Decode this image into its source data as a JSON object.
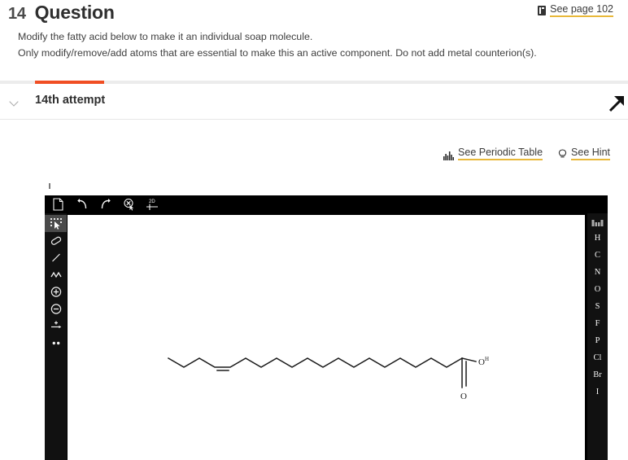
{
  "header": {
    "question_number": "14",
    "question_label": "Question",
    "instruction_1": "Modify the fatty acid below to make it an individual soap molecule.",
    "instruction_2": "Only modify/remove/add atoms that are essential to make this an active component. Do not add metal counterion(s).",
    "see_page_label": "See page 102",
    "see_page_icon": "book-icon"
  },
  "progress": {
    "fill_color": "#f04e23",
    "track_color": "#ececec"
  },
  "attempt": {
    "label": "14th attempt",
    "chevron_icon": "chevron-down-icon",
    "expand_icon": "arrow-up-right-icon"
  },
  "links": [
    {
      "label": "See Periodic Table",
      "icon": "periodic-table-icon",
      "underline_color": "#e8b83a"
    },
    {
      "label": "See Hint",
      "icon": "lightbulb-icon",
      "underline_color": "#e8b83a"
    }
  ],
  "editor": {
    "top_tools": [
      {
        "name": "new-document-icon",
        "label": "New"
      },
      {
        "name": "undo-icon",
        "label": "Undo"
      },
      {
        "name": "redo-icon",
        "label": "Redo"
      },
      {
        "name": "erase-cursor-icon",
        "label": "Erase"
      },
      {
        "name": "clean-up-2d-icon",
        "label": "2D"
      }
    ],
    "left_tools": [
      {
        "name": "select-tool-icon",
        "label": "Select",
        "active": true
      },
      {
        "name": "eraser-tool-icon",
        "label": "Eraser",
        "active": false
      },
      {
        "name": "single-bond-tool-icon",
        "label": "Single Bond",
        "active": false
      },
      {
        "name": "chain-tool-icon",
        "label": "Chain",
        "active": false
      },
      {
        "name": "increase-charge-icon",
        "label": "Increase Charge",
        "active": false
      },
      {
        "name": "decrease-charge-icon",
        "label": "Decrease Charge",
        "active": false
      },
      {
        "name": "reaction-arrow-icon",
        "label": "Reaction Arrow",
        "active": false
      },
      {
        "name": "lone-pair-icon",
        "label": "Lone Pair",
        "active": false
      }
    ],
    "element_palette": {
      "periodic_table_icon": "periodic-table-icon",
      "elements": [
        "H",
        "C",
        "N",
        "O",
        "S",
        "F",
        "P",
        "Cl",
        "Br",
        "I"
      ]
    },
    "molecule": {
      "description": "Unsaturated fatty acid (oleic acid) drawn as a zigzag skeletal chain with one cis double bond and a terminal carboxylic acid group",
      "hydroxyl_label": "O",
      "hydroxyl_superscript": "H",
      "carbonyl_label": "O",
      "bond_color": "#1a1a1a",
      "vertices_x": [
        207,
        226,
        245,
        264,
        283,
        302,
        321,
        340,
        359,
        378,
        397,
        416,
        435,
        454,
        473,
        492,
        511,
        530,
        549,
        568
      ],
      "vertices_y": [
        416,
        427,
        416,
        427,
        427,
        416,
        427,
        416,
        427,
        416,
        427,
        416,
        427,
        416,
        427,
        416,
        427,
        416,
        427,
        416
      ],
      "double_bond_index": 3
    }
  }
}
